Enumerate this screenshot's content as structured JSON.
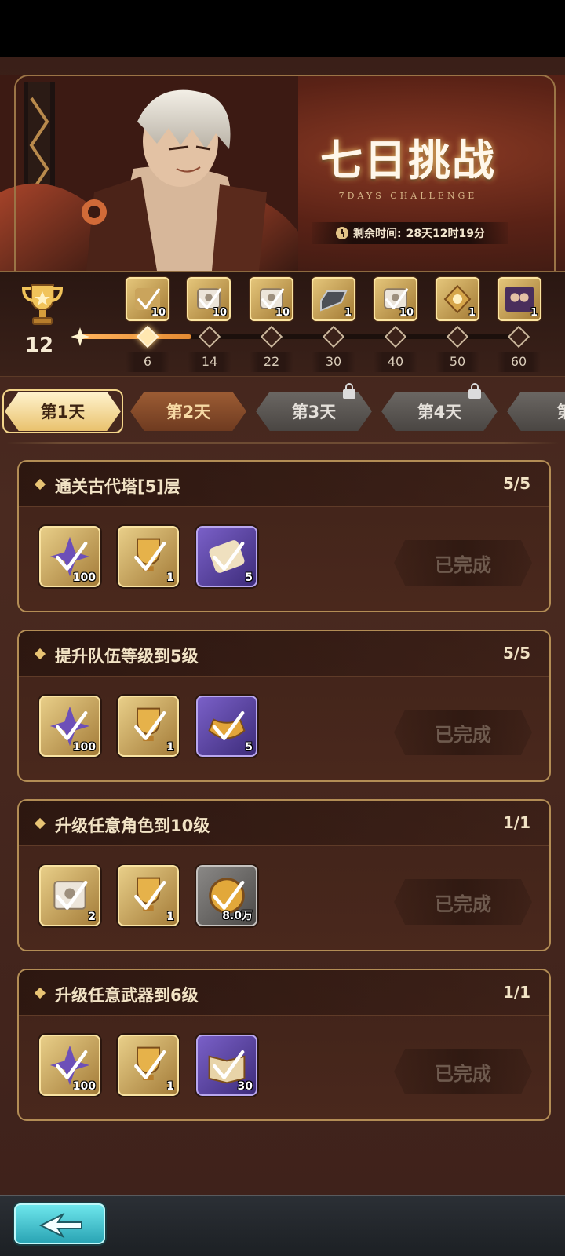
{
  "banner": {
    "title": "七日挑战",
    "subtitle": "7DAYS CHALLENGE",
    "timer_label": "剩余时间:",
    "timer_value": "28天12时19分"
  },
  "progress": {
    "current_points": "12",
    "max_points": 60,
    "fill_fraction": 0.25,
    "milestones": [
      {
        "label": "6",
        "reward_icon": "ticket-check-icon",
        "count": "10",
        "reached": true
      },
      {
        "label": "14",
        "reward_icon": "summon-ticket-icon",
        "count": "10",
        "reached": false
      },
      {
        "label": "22",
        "reward_icon": "summon-ticket-icon",
        "count": "10",
        "reached": false
      },
      {
        "label": "30",
        "reward_icon": "ingot-icon",
        "count": "1",
        "reached": false
      },
      {
        "label": "40",
        "reward_icon": "summon-ticket-icon",
        "count": "10",
        "reached": false
      },
      {
        "label": "50",
        "reward_icon": "gold-emblem-icon",
        "count": "1",
        "reached": false
      },
      {
        "label": "60",
        "reward_icon": "character-portrait-icon",
        "count": "1",
        "reached": false
      }
    ]
  },
  "tabs": [
    {
      "label": "第1天",
      "state": "active"
    },
    {
      "label": "第2天",
      "state": "unlocked"
    },
    {
      "label": "第3天",
      "state": "locked"
    },
    {
      "label": "第4天",
      "state": "locked"
    },
    {
      "label": "第",
      "state": "locked"
    }
  ],
  "tasks": [
    {
      "title": "通关古代塔[5]层",
      "progress": "5/5",
      "button": "已完成",
      "rewards": [
        {
          "icon": "star-crystal-icon",
          "style": "gold",
          "count": "100"
        },
        {
          "icon": "trophy-icon",
          "style": "gold",
          "count": "1"
        },
        {
          "icon": "scroll-icon",
          "style": "purple",
          "count": "5"
        }
      ]
    },
    {
      "title": "提升队伍等级到5级",
      "progress": "5/5",
      "button": "已完成",
      "rewards": [
        {
          "icon": "star-crystal-icon",
          "style": "gold",
          "count": "100"
        },
        {
          "icon": "trophy-icon",
          "style": "gold",
          "count": "1"
        },
        {
          "icon": "gold-ingot-icon",
          "style": "purple",
          "count": "5"
        }
      ]
    },
    {
      "title": "升级任意角色到10级",
      "progress": "1/1",
      "button": "已完成",
      "rewards": [
        {
          "icon": "summon-ticket-icon",
          "style": "gold",
          "count": "2"
        },
        {
          "icon": "trophy-icon",
          "style": "gold",
          "count": "1"
        },
        {
          "icon": "gold-coin-icon",
          "style": "grey",
          "count": "8.0万"
        }
      ]
    },
    {
      "title": "升级任意武器到6级",
      "progress": "1/1",
      "button": "已完成",
      "rewards": [
        {
          "icon": "star-crystal-icon",
          "style": "gold",
          "count": "100"
        },
        {
          "icon": "trophy-icon",
          "style": "gold",
          "count": "1"
        },
        {
          "icon": "book-icon",
          "style": "purple",
          "count": "30"
        }
      ]
    }
  ],
  "colors": {
    "accent_gold": "#e8c474",
    "panel_bg": "#4a2a20",
    "tab_active": "#f3d58a",
    "back_button": "#2aa4b4"
  }
}
